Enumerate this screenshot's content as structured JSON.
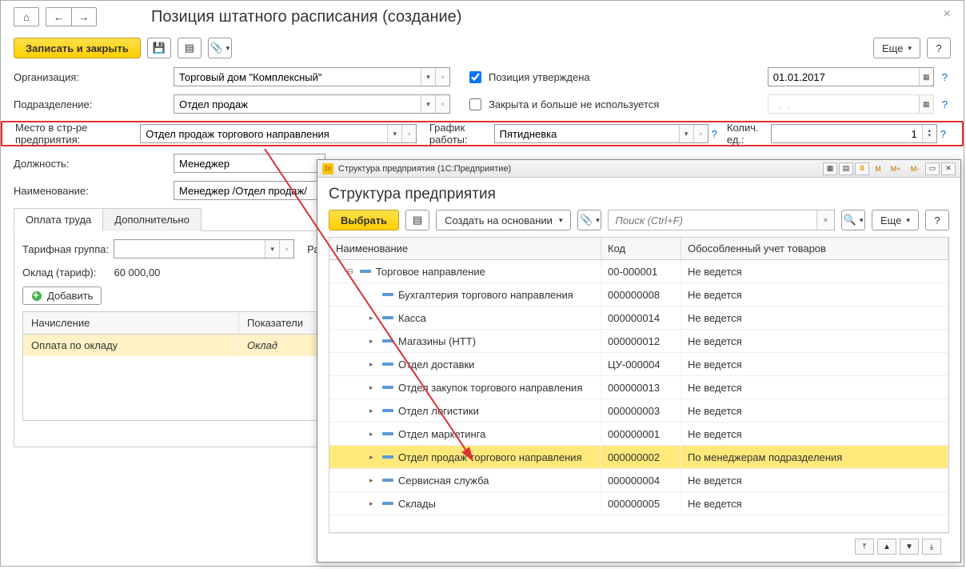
{
  "page_title": "Позиция штатного расписания (создание)",
  "toolbar": {
    "save_close": "Записать и закрыть",
    "more": "Еще",
    "help": "?"
  },
  "form": {
    "org_label": "Организация:",
    "org_value": "Торговый дом \"Комплексный\"",
    "approved_label": "Позиция утверждена",
    "date_value": "01.01.2017",
    "dept_label": "Подразделение:",
    "dept_value": "Отдел продаж",
    "closed_label": "Закрыта и больше не используется",
    "place_label": "Место в стр-ре предприятия:",
    "place_value": "Отдел продаж торгового направления",
    "schedule_label": "График работы:",
    "schedule_value": "Пятидневка",
    "qty_label": "Колич. ед.:",
    "qty_value": "1",
    "position_label": "Должность:",
    "position_value": "Менеджер",
    "name_label": "Наименование:",
    "name_value": "Менеджер /Отдел продаж/"
  },
  "tabs": {
    "pay": "Оплата труда",
    "extra": "Дополнительно"
  },
  "pay_tab": {
    "tariff_group_label": "Тарифная группа:",
    "rank_label": "Разря",
    "salary_label": "Оклад (тариф):",
    "salary_value": "60 000,00",
    "add_btn": "Добавить",
    "col_accrual": "Начисление",
    "col_indicators": "Показатели",
    "row_accrual": "Оплата по окладу",
    "row_indicator": "Оклад"
  },
  "dialog": {
    "titlebar": "Структура предприятия  (1С:Предприятие)",
    "heading": "Структура предприятия",
    "select_btn": "Выбрать",
    "create_based": "Создать на основании",
    "search_placeholder": "Поиск (Ctrl+F)",
    "more": "Еще",
    "help": "?",
    "col_name": "Наименование",
    "col_code": "Код",
    "col_sep": "Обособленный учет товаров",
    "tb": {
      "m": "M",
      "mp": "M+",
      "mm": "M-"
    },
    "rows": [
      {
        "lvl": 0,
        "exp": "⊟",
        "name": "Торговое направление",
        "code": "00-000001",
        "sep": "Не ведется"
      },
      {
        "lvl": 1,
        "exp": "",
        "name": "Бухгалтерия торгового направления",
        "code": "000000008",
        "sep": "Не ведется"
      },
      {
        "lvl": 1,
        "exp": "▸",
        "name": "Касса",
        "code": "000000014",
        "sep": "Не ведется"
      },
      {
        "lvl": 1,
        "exp": "▸",
        "name": "Магазины (НТТ)",
        "code": "000000012",
        "sep": "Не ведется"
      },
      {
        "lvl": 1,
        "exp": "▸",
        "name": "Отдел доставки",
        "code": "ЦУ-000004",
        "sep": "Не ведется"
      },
      {
        "lvl": 1,
        "exp": "▸",
        "name": "Отдел закупок торгового направления",
        "code": "000000013",
        "sep": "Не ведется"
      },
      {
        "lvl": 1,
        "exp": "▸",
        "name": "Отдел логистики",
        "code": "000000003",
        "sep": "Не ведется"
      },
      {
        "lvl": 1,
        "exp": "▸",
        "name": "Отдел маркетинга",
        "code": "000000001",
        "sep": "Не ведется"
      },
      {
        "lvl": 1,
        "exp": "▸",
        "name": "Отдел продаж торгового направления",
        "code": "000000002",
        "sep": "По менеджерам подразделения",
        "sel": true
      },
      {
        "lvl": 1,
        "exp": "▸",
        "name": "Сервисная служба",
        "code": "000000004",
        "sep": "Не ведется"
      },
      {
        "lvl": 1,
        "exp": "▸",
        "name": "Склады",
        "code": "000000005",
        "sep": "Не ведется"
      }
    ]
  }
}
